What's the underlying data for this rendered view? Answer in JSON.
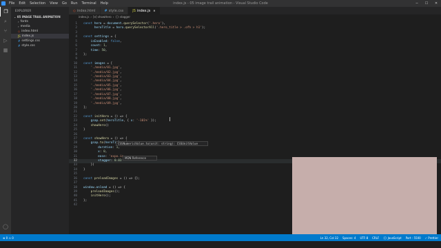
{
  "window": {
    "title": "index.js - 05 image trail animation - Visual Studio Code",
    "menu": [
      "File",
      "Edit",
      "Selection",
      "View",
      "Go",
      "Run",
      "Terminal",
      "Help"
    ]
  },
  "sidebar": {
    "title": "EXPLORER",
    "section": "05 IMAGE TRAIL ANIMATION",
    "items": [
      {
        "label": "fonts",
        "icon": "chevron-right"
      },
      {
        "label": "media",
        "icon": "chevron-right"
      },
      {
        "label": "index.html",
        "icon": "html-file"
      },
      {
        "label": "index.js",
        "icon": "js-file"
      },
      {
        "label": "settings.css",
        "icon": "css-file"
      },
      {
        "label": "style.css",
        "icon": "css-file"
      }
    ],
    "timeline": "TIMELINE"
  },
  "tabs": [
    {
      "label": "index.html",
      "icon": "html-file"
    },
    {
      "label": "style.css",
      "icon": "css-file"
    },
    {
      "label": "index.js",
      "icon": "js-file"
    }
  ],
  "breadcrumb": [
    "index.js",
    "[e] showHero",
    "{} stagger"
  ],
  "code": [
    {
      "n": "1",
      "t": [
        [
          "kw",
          "const "
        ],
        [
          "var",
          "hero"
        ],
        [
          "pl",
          " = "
        ],
        [
          "var",
          "document"
        ],
        [
          "pl",
          "."
        ],
        [
          "fn",
          "querySelector"
        ],
        [
          "pl",
          "("
        ],
        [
          "str",
          "'.hero'"
        ],
        [
          "pl",
          "),"
        ]
      ]
    },
    {
      "n": "2",
      "t": [
        [
          "pl",
          "      "
        ],
        [
          "var",
          "heroTitle"
        ],
        [
          "pl",
          " = "
        ],
        [
          "var",
          "hero"
        ],
        [
          "pl",
          "."
        ],
        [
          "fn",
          "querySelectorAll"
        ],
        [
          "pl",
          "("
        ],
        [
          "str",
          "'.hero_title > .ofh > h1'"
        ],
        [
          "pl",
          ");"
        ]
      ]
    },
    {
      "n": "3",
      "t": []
    },
    {
      "n": "4",
      "t": [
        [
          "kw",
          "const "
        ],
        [
          "var",
          "settings"
        ],
        [
          "pl",
          " = {"
        ]
      ]
    },
    {
      "n": "5",
      "t": [
        [
          "pl",
          "    "
        ],
        [
          "var",
          "isEnabled"
        ],
        [
          "pl",
          ": "
        ],
        [
          "kw",
          "false"
        ],
        [
          "pl",
          ","
        ]
      ]
    },
    {
      "n": "6",
      "t": [
        [
          "pl",
          "    "
        ],
        [
          "var",
          "count"
        ],
        [
          "pl",
          ": "
        ],
        [
          "num",
          "1"
        ],
        [
          "pl",
          ","
        ]
      ]
    },
    {
      "n": "7",
      "t": [
        [
          "pl",
          "    "
        ],
        [
          "var",
          "time"
        ],
        [
          "pl",
          ": "
        ],
        [
          "num",
          "50"
        ],
        [
          "pl",
          ","
        ]
      ]
    },
    {
      "n": "8",
      "t": [
        [
          "pl",
          "};"
        ]
      ]
    },
    {
      "n": "9",
      "t": []
    },
    {
      "n": "10",
      "t": [
        [
          "kw",
          "const "
        ],
        [
          "var",
          "images"
        ],
        [
          "pl",
          " = ["
        ]
      ]
    },
    {
      "n": "11",
      "t": [
        [
          "pl",
          "    "
        ],
        [
          "str",
          "'./media/01.jpg'"
        ],
        [
          "pl",
          ","
        ]
      ]
    },
    {
      "n": "12",
      "t": [
        [
          "pl",
          "    "
        ],
        [
          "str",
          "'./media/02.jpg'"
        ],
        [
          "pl",
          ","
        ]
      ]
    },
    {
      "n": "13",
      "t": [
        [
          "pl",
          "    "
        ],
        [
          "str",
          "'./media/03.jpg'"
        ],
        [
          "pl",
          ","
        ]
      ]
    },
    {
      "n": "14",
      "t": [
        [
          "pl",
          "    "
        ],
        [
          "str",
          "'./media/04.jpg'"
        ],
        [
          "pl",
          ","
        ]
      ]
    },
    {
      "n": "15",
      "t": [
        [
          "pl",
          "    "
        ],
        [
          "str",
          "'./media/05.jpg'"
        ],
        [
          "pl",
          ","
        ]
      ]
    },
    {
      "n": "16",
      "t": [
        [
          "pl",
          "    "
        ],
        [
          "str",
          "'./media/06.jpg'"
        ],
        [
          "pl",
          ","
        ]
      ]
    },
    {
      "n": "17",
      "t": [
        [
          "pl",
          "    "
        ],
        [
          "str",
          "'./media/07.jpg'"
        ],
        [
          "pl",
          ","
        ]
      ]
    },
    {
      "n": "18",
      "t": [
        [
          "pl",
          "    "
        ],
        [
          "str",
          "'./media/08.jpg'"
        ],
        [
          "pl",
          ","
        ]
      ]
    },
    {
      "n": "19",
      "t": [
        [
          "pl",
          "    "
        ],
        [
          "str",
          "'./media/09.jpg'"
        ],
        [
          "pl",
          ","
        ]
      ]
    },
    {
      "n": "20",
      "t": [
        [
          "pl",
          "];"
        ]
      ]
    },
    {
      "n": "21",
      "t": []
    },
    {
      "n": "22",
      "t": [
        [
          "kw",
          "const "
        ],
        [
          "fn",
          "initHero"
        ],
        [
          "pl",
          " = () => {"
        ]
      ]
    },
    {
      "n": "23",
      "t": [
        [
          "pl",
          "    "
        ],
        [
          "var",
          "gsap"
        ],
        [
          "pl",
          "."
        ],
        [
          "fn",
          "set"
        ],
        [
          "pl",
          "("
        ],
        [
          "var",
          "heroTitle"
        ],
        [
          "pl",
          ", { "
        ],
        [
          "var",
          "x"
        ],
        [
          "pl",
          ": "
        ],
        [
          "str",
          "'-101%'"
        ],
        [
          "pl",
          " });"
        ]
      ]
    },
    {
      "n": "24",
      "t": [
        [
          "pl",
          "    "
        ],
        [
          "fn",
          "showHero"
        ],
        [
          "pl",
          "()"
        ]
      ]
    },
    {
      "n": "25",
      "t": [
        [
          "pl",
          "}"
        ]
      ]
    },
    {
      "n": "26",
      "t": []
    },
    {
      "n": "27",
      "t": [
        [
          "kw",
          "const "
        ],
        [
          "fn",
          "showHero"
        ],
        [
          "pl",
          " = () => {"
        ]
      ]
    },
    {
      "n": "28",
      "t": [
        [
          "pl",
          "    "
        ],
        [
          "var",
          "gsap"
        ],
        [
          "pl",
          "."
        ],
        [
          "fn",
          "to"
        ],
        [
          "pl",
          "("
        ],
        [
          "var",
          "heroTitle"
        ],
        [
          "pl",
          ", {"
        ]
      ]
    },
    {
      "n": "29",
      "t": [
        [
          "pl",
          "        "
        ],
        [
          "var",
          "duration"
        ],
        [
          "pl",
          ": "
        ],
        [
          "num",
          "1"
        ],
        [
          "pl",
          ","
        ]
      ]
    },
    {
      "n": "30",
      "t": [
        [
          "pl",
          "        "
        ],
        [
          "var",
          "x"
        ],
        [
          "pl",
          ": "
        ],
        [
          "num",
          "0"
        ],
        [
          "pl",
          ","
        ]
      ]
    },
    {
      "n": "31",
      "t": [
        [
          "pl",
          "        "
        ],
        [
          "var",
          "ease"
        ],
        [
          "pl",
          ": "
        ],
        [
          "str",
          "'expo.in"
        ]
      ]
    },
    {
      "n": "32",
      "t": [
        [
          "pl",
          "        "
        ],
        [
          "var",
          "stagger"
        ],
        [
          "pl",
          ": "
        ],
        [
          "num",
          "0.03"
        ]
      ]
    },
    {
      "n": "33",
      "t": [
        [
          "pl",
          "    })"
        ]
      ]
    },
    {
      "n": "34",
      "t": [
        [
          "pl",
          "}"
        ]
      ]
    },
    {
      "n": "35",
      "t": []
    },
    {
      "n": "36",
      "t": [
        [
          "kw",
          "const "
        ],
        [
          "fn",
          "preloadImages"
        ],
        [
          "pl",
          " = () => {};"
        ]
      ]
    },
    {
      "n": "37",
      "t": []
    },
    {
      "n": "38",
      "t": [
        [
          "var",
          "window"
        ],
        [
          "pl",
          "."
        ],
        [
          "var",
          "onload"
        ],
        [
          "pl",
          " = () => {"
        ]
      ]
    },
    {
      "n": "39",
      "t": [
        [
          "pl",
          "    "
        ],
        [
          "fn",
          "preloadImages"
        ],
        [
          "pl",
          "();"
        ]
      ]
    },
    {
      "n": "40",
      "t": [
        [
          "pl",
          "    "
        ],
        [
          "fn",
          "initHero"
        ],
        [
          "pl",
          "();"
        ]
      ]
    },
    {
      "n": "41",
      "t": [
        [
          "pl",
          "};"
        ]
      ]
    },
    {
      "n": "42",
      "t": []
    }
  ],
  "current_line": "32",
  "hover": {
    "signature": "CSSNumericValue.to(unit: string): CSSUnitValue",
    "reference": "MDN Reference"
  },
  "status": {
    "left": [
      "⊗ 0  ⚠ 0"
    ],
    "right": [
      "Ln 32, Col 32",
      "Spaces: 4",
      "UTF-8",
      "CRLF",
      "{} JavaScript",
      "Port : 5500",
      "✓ Prettier"
    ]
  },
  "colors": {
    "accent": "#007acc",
    "editor_bg": "#1e1e1e",
    "overlay": "#c6aeab"
  }
}
